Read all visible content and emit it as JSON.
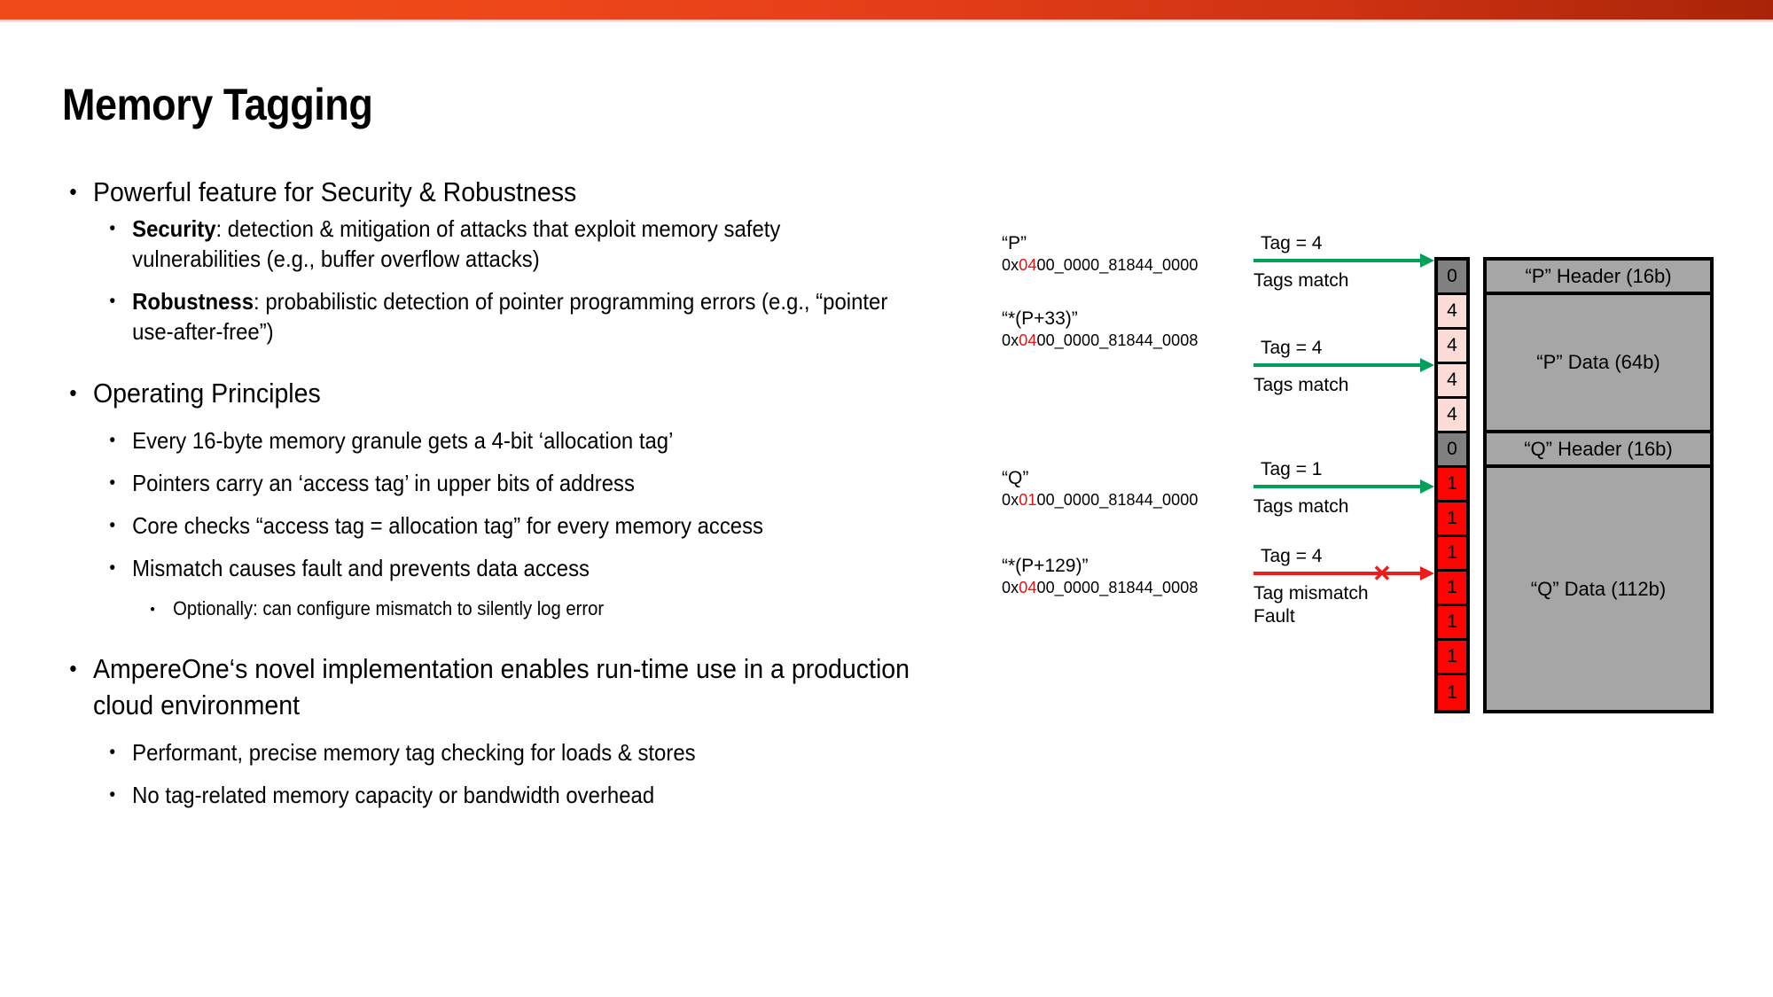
{
  "theme": {
    "accent_start": "#f04a18",
    "accent_end": "#a82408",
    "match_green": "#00a05a",
    "mismatch_red": "#ee1c1c",
    "tag_highlight_red": "#e8110f",
    "tag_zero_bg": "#808080",
    "tag_four_bg": "#fbdcd7",
    "tag_one_bg": "#ff0202",
    "memory_bg": "#a6a6a6"
  },
  "title": "Memory Tagging",
  "bullets": {
    "b1_label": "Powerful feature for Security & Robustness",
    "b1_sub1_lead": "Security",
    "b1_sub1_rest": ": detection & mitigation of attacks that exploit memory safety vulnerabilities (e.g., buffer overflow attacks)",
    "b1_sub2_lead": "Robustness",
    "b1_sub2_rest": ": probabilistic detection of pointer programming errors (e.g., “pointer use-after-free”)",
    "b2_label": "Operating Principles",
    "b2_sub1": "Every 16-byte memory granule gets a 4-bit ‘allocation tag’",
    "b2_sub2": "Pointers carry an ‘access tag’ in upper bits of address",
    "b2_sub3": "Core checks “access tag = allocation tag” for every memory access",
    "b2_sub4": "Mismatch causes fault and prevents data access",
    "b2_sub4_sub1": "Optionally: can configure mismatch to silently log error",
    "b3_label": "AmpereOne‘s novel implementation enables run-time use in a production cloud environment",
    "b3_sub1": "Performant, precise memory tag checking for loads & stores",
    "b3_sub2": "No tag-related memory capacity or bandwidth overhead"
  },
  "diagram": {
    "pointers": [
      {
        "name": "“P”",
        "addr_prefix": "0x",
        "addr_tag": "04",
        "addr_rest": "00_0000_81844_0000",
        "tag_caption": "Tag = 4",
        "result_line1": "Tags match",
        "result_line2": "",
        "status": "match"
      },
      {
        "name": "“*(P+33)”",
        "addr_prefix": "0x",
        "addr_tag": "04",
        "addr_rest": "00_0000_81844_0008",
        "tag_caption": "Tag = 4",
        "result_line1": "Tags match",
        "result_line2": "",
        "status": "match"
      },
      {
        "name": "“Q”",
        "addr_prefix": "0x",
        "addr_tag": "01",
        "addr_rest": "00_0000_81844_0000",
        "tag_caption": "Tag = 1",
        "result_line1": "Tags match",
        "result_line2": "",
        "status": "match"
      },
      {
        "name": "“*(P+129)”",
        "addr_prefix": "0x",
        "addr_tag": "04",
        "addr_rest": "00_0000_81844_0008",
        "tag_caption": "Tag = 4",
        "result_line1": "Tag mismatch",
        "result_line2": "Fault",
        "status": "mismatch",
        "x_glyph": "✕"
      }
    ],
    "tag_cells": [
      {
        "value": "0",
        "kind": "zero"
      },
      {
        "value": "4",
        "kind": "four"
      },
      {
        "value": "4",
        "kind": "four"
      },
      {
        "value": "4",
        "kind": "four"
      },
      {
        "value": "4",
        "kind": "four"
      },
      {
        "value": "0",
        "kind": "zero"
      },
      {
        "value": "1",
        "kind": "one"
      },
      {
        "value": "1",
        "kind": "one"
      },
      {
        "value": "1",
        "kind": "one"
      },
      {
        "value": "1",
        "kind": "one"
      },
      {
        "value": "1",
        "kind": "one"
      },
      {
        "value": "1",
        "kind": "one"
      },
      {
        "value": "1",
        "kind": "one"
      }
    ],
    "memory_blocks": [
      {
        "label": "“P” Header (16b)",
        "rows": 1
      },
      {
        "label": "“P” Data (64b)",
        "rows": 4
      },
      {
        "label": "“Q” Header (16b)",
        "rows": 1
      },
      {
        "label": "“Q” Data (112b)",
        "rows": 7
      }
    ]
  }
}
